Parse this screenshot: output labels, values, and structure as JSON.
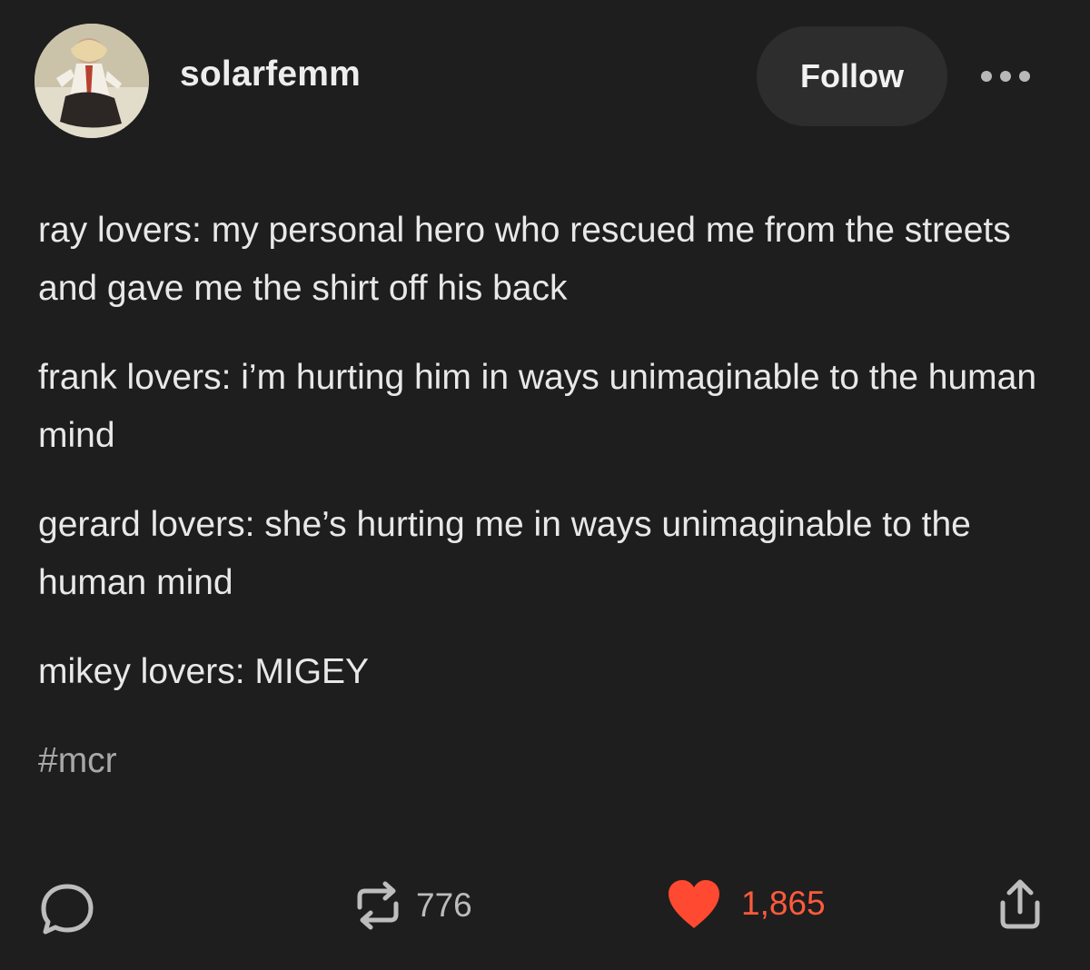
{
  "header": {
    "username": "solarfemm",
    "follow_label": "Follow",
    "more_icon": "ellipsis-icon"
  },
  "post": {
    "paragraphs": [
      "ray lovers: my personal hero who rescued me from the streets and gave me the shirt off his back",
      "frank lovers: i’m hurting him in ways unimaginable to the human mind",
      "gerard lovers: she’s hurting me in ways unimaginable to the human mind",
      "mikey lovers: MIGEY"
    ],
    "tag": "#mcr"
  },
  "footer": {
    "comment_icon": "comment-icon",
    "reblog_icon": "reblog-icon",
    "reblog_count": "776",
    "like_icon": "heart-icon",
    "like_count": "1,865",
    "share_icon": "share-icon"
  },
  "colors": {
    "background": "#1e1e1e",
    "button_bg": "#2d2d2d",
    "like_accent": "#ff5a3c",
    "text": "#e8e8e8",
    "muted": "#a8a8a8"
  }
}
